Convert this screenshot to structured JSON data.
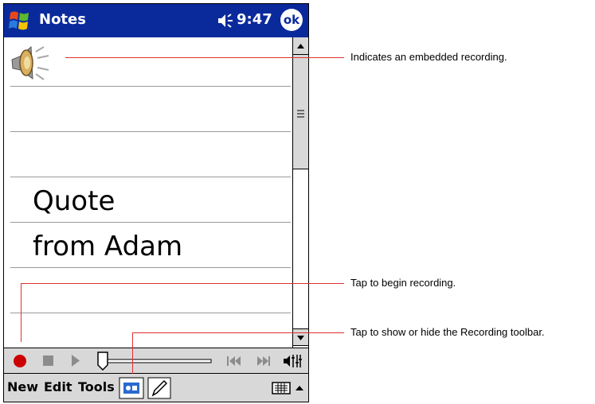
{
  "titlebar": {
    "app_title": "Notes",
    "time": "9:47",
    "ok_label": "ok"
  },
  "note": {
    "line1": "Quote",
    "line2": "from Adam"
  },
  "menubar": {
    "new": "New",
    "edit": "Edit",
    "tools": "Tools"
  },
  "callouts": {
    "embedded": "Indicates an embedded recording.",
    "record": "Tap to begin recording.",
    "toolbar": "Tap to show or hide the Recording toolbar."
  },
  "colors": {
    "titlebar": "#0a2a9c",
    "callout_line": "#e03030",
    "record": "#cc0000",
    "chrome": "#d8d8d8"
  },
  "icons": [
    "windows-start-icon",
    "speaker-volume-icon",
    "embedded-recording-icon",
    "record-icon",
    "stop-icon",
    "play-icon",
    "volume-slider",
    "skip-back-icon",
    "skip-forward-icon",
    "speaker-toggle-icon",
    "recording-toolbar-icon",
    "pen-icon",
    "keyboard-icon",
    "input-menu-arrow-icon"
  ]
}
